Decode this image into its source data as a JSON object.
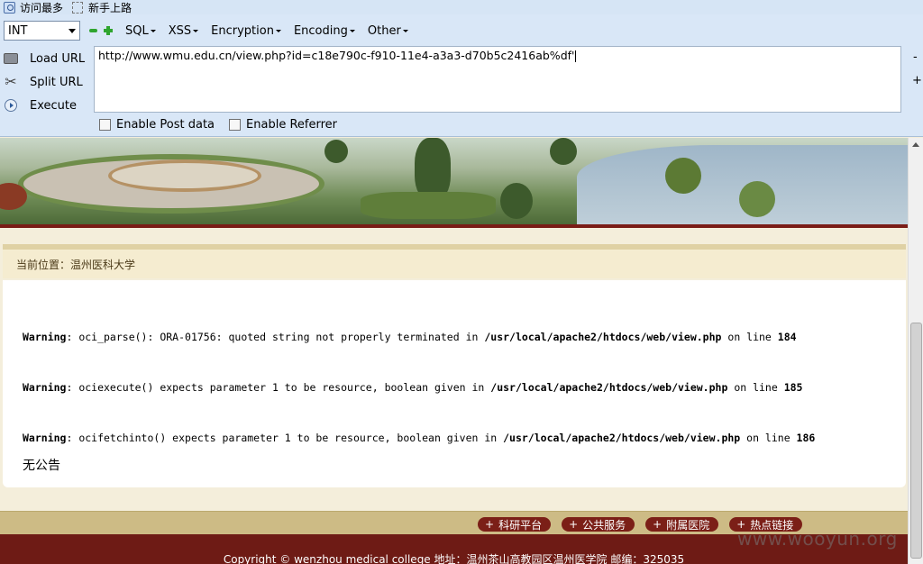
{
  "bookmarks": [
    {
      "label": "访问最多",
      "icon": "bookmark-icon"
    },
    {
      "label": "新手上路",
      "icon": "dashed-page-icon"
    }
  ],
  "hackbar": {
    "type_select": "INT",
    "menus": [
      "SQL",
      "XSS",
      "Encryption",
      "Encoding",
      "Other"
    ],
    "side_buttons": {
      "load": "Load URL",
      "split": "Split URL",
      "execute": "Execute"
    },
    "url": "http://www.wmu.edu.cn/view.php?id=c18e790c-f910-11e4-a3a3-d70b5c2416ab%df'",
    "options": {
      "post": "Enable Post data",
      "referrer": "Enable Referrer"
    },
    "zoom_minus": "-",
    "zoom_plus": "+"
  },
  "page": {
    "breadcrumb": "当前位置：温州医科大学",
    "warnings": [
      {
        "label": "Warning",
        "text": ": oci_parse(): ORA-01756: quoted string not properly terminated in ",
        "path": "/usr/local/apache2/htdocs/web/view.php",
        "mid": " on line ",
        "line": "184"
      },
      {
        "label": "Warning",
        "text": ": ociexecute() expects parameter 1 to be resource, boolean given in ",
        "path": "/usr/local/apache2/htdocs/web/view.php",
        "mid": " on line ",
        "line": "185"
      },
      {
        "label": "Warning",
        "text": ": ocifetchinto() expects parameter 1 to be resource, boolean given in ",
        "path": "/usr/local/apache2/htdocs/web/view.php",
        "mid": " on line ",
        "line": "186"
      }
    ],
    "notice": "无公告",
    "footer_links": [
      "科研平台",
      "公共服务",
      "附属医院",
      "热点链接"
    ],
    "copyright": "Copyright © wenzhou medical college 地址：温州茶山高教园区温州医学院 邮编：325035",
    "watermark": "www.wooyun.org"
  },
  "colors": {
    "hackbar_bg": "#d9e7f7",
    "footer_red": "#6e1b15",
    "footer_tan": "#cdbb85"
  }
}
